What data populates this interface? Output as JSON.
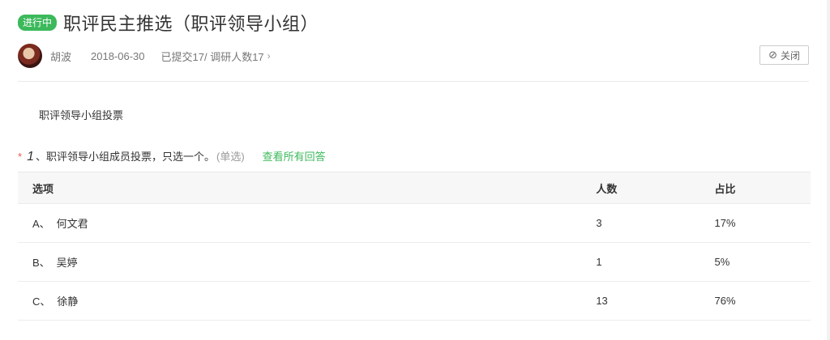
{
  "header": {
    "status": "进行中",
    "title": "职评民主推选（职评领导小组）",
    "author": "胡波",
    "date": "2018-06-30",
    "submitted_text": "已提交17/ 调研人数17",
    "close_label": "关闭"
  },
  "description": "职评领导小组投票",
  "question": {
    "required_mark": "*",
    "number": "1",
    "text": "、职评领导小组成员投票，只选一个。",
    "type": "(单选)",
    "view_all": "查看所有回答"
  },
  "table": {
    "headers": [
      "选项",
      "人数",
      "占比"
    ],
    "rows": [
      {
        "label": "A、",
        "name": "何文君",
        "count": "3",
        "percent": "17%"
      },
      {
        "label": "B、",
        "name": "吴婷",
        "count": "1",
        "percent": "5%"
      },
      {
        "label": "C、",
        "name": "徐静",
        "count": "13",
        "percent": "76%"
      }
    ]
  },
  "colors": {
    "accent": "#3cb95b",
    "required": "#e85b4d"
  }
}
